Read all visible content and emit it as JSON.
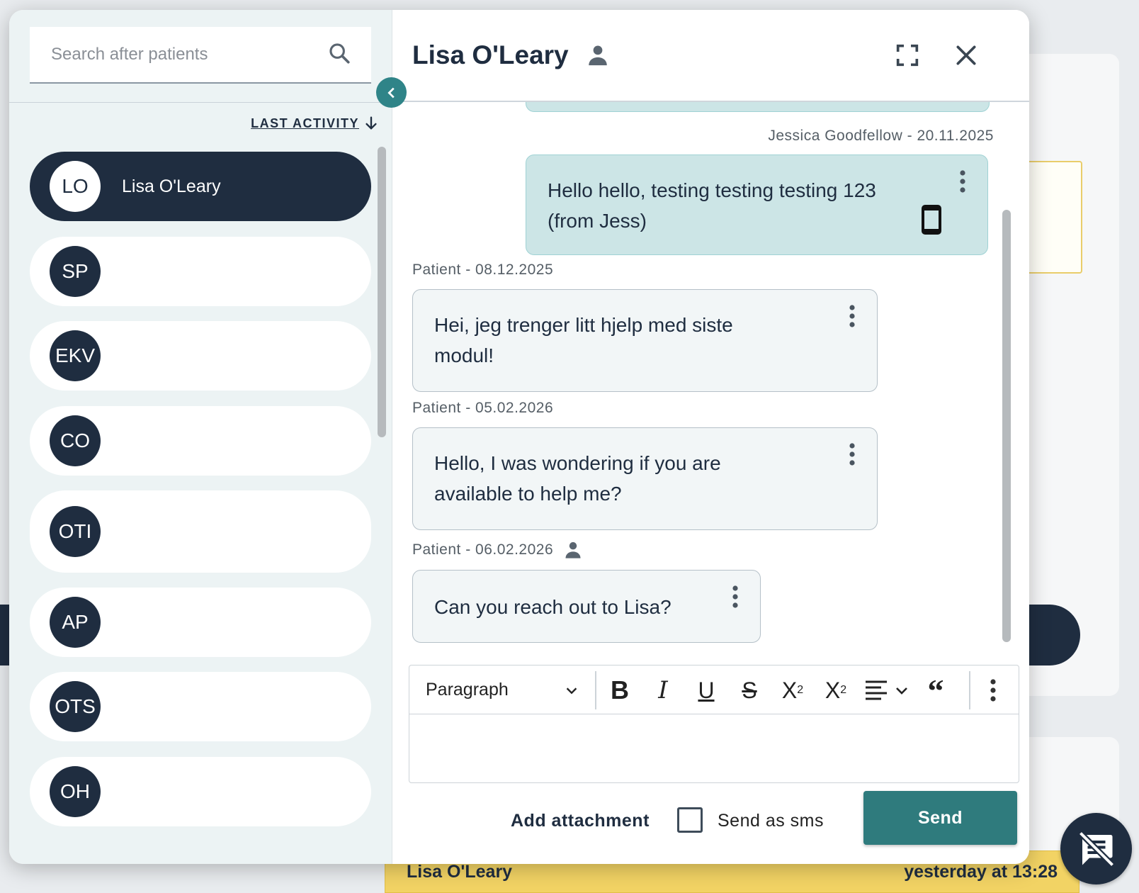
{
  "background": {
    "bar_name": "Lisa O'Leary",
    "bar_time": "yesterday at 13:28"
  },
  "search": {
    "placeholder": "Search after patients"
  },
  "sort": {
    "label": "LAST ACTIVITY"
  },
  "patients": [
    {
      "initials": "LO",
      "name": "Lisa O'Leary",
      "active": true
    },
    {
      "initials": "SP",
      "name": "",
      "active": false
    },
    {
      "initials": "EKV",
      "name": "",
      "active": false
    },
    {
      "initials": "CO",
      "name": "",
      "active": false
    },
    {
      "initials": "OTI",
      "name": "",
      "active": false
    },
    {
      "initials": "AP",
      "name": "",
      "active": false
    },
    {
      "initials": "OTS",
      "name": "",
      "active": false
    },
    {
      "initials": "OH",
      "name": "",
      "active": false
    }
  ],
  "conversation": {
    "title": "Lisa O'Leary",
    "messages": [
      {
        "meta": "Jessica Goodfellow - 20.11.2025",
        "text": "Hello hello, testing testing testing 123 (from Jess)",
        "direction": "out",
        "icon": "smartphone-icon"
      },
      {
        "meta": "Patient - 08.12.2025",
        "text": "Hei, jeg trenger litt hjelp med siste modul!",
        "direction": "in"
      },
      {
        "meta": "Patient - 05.02.2026",
        "text": "Hello, I was wondering if you are available to help me?",
        "direction": "in"
      },
      {
        "meta": "Patient - 06.02.2026",
        "text": "Can you reach out to Lisa?",
        "direction": "in",
        "meta_icon": "person-icon"
      }
    ]
  },
  "editor": {
    "block_format": "Paragraph",
    "tools": [
      "bold",
      "italic",
      "underline",
      "strikethrough",
      "subscript",
      "superscript",
      "align",
      "blockquote",
      "more"
    ]
  },
  "footer": {
    "add_attachment": "Add attachment",
    "send_as_sms": "Send as sms",
    "send": "Send"
  },
  "colors": {
    "navy": "#1f2d40",
    "teal": "#2f7b7d",
    "bubble_out": "#cce5e6",
    "bubble_in": "#f2f6f7"
  }
}
